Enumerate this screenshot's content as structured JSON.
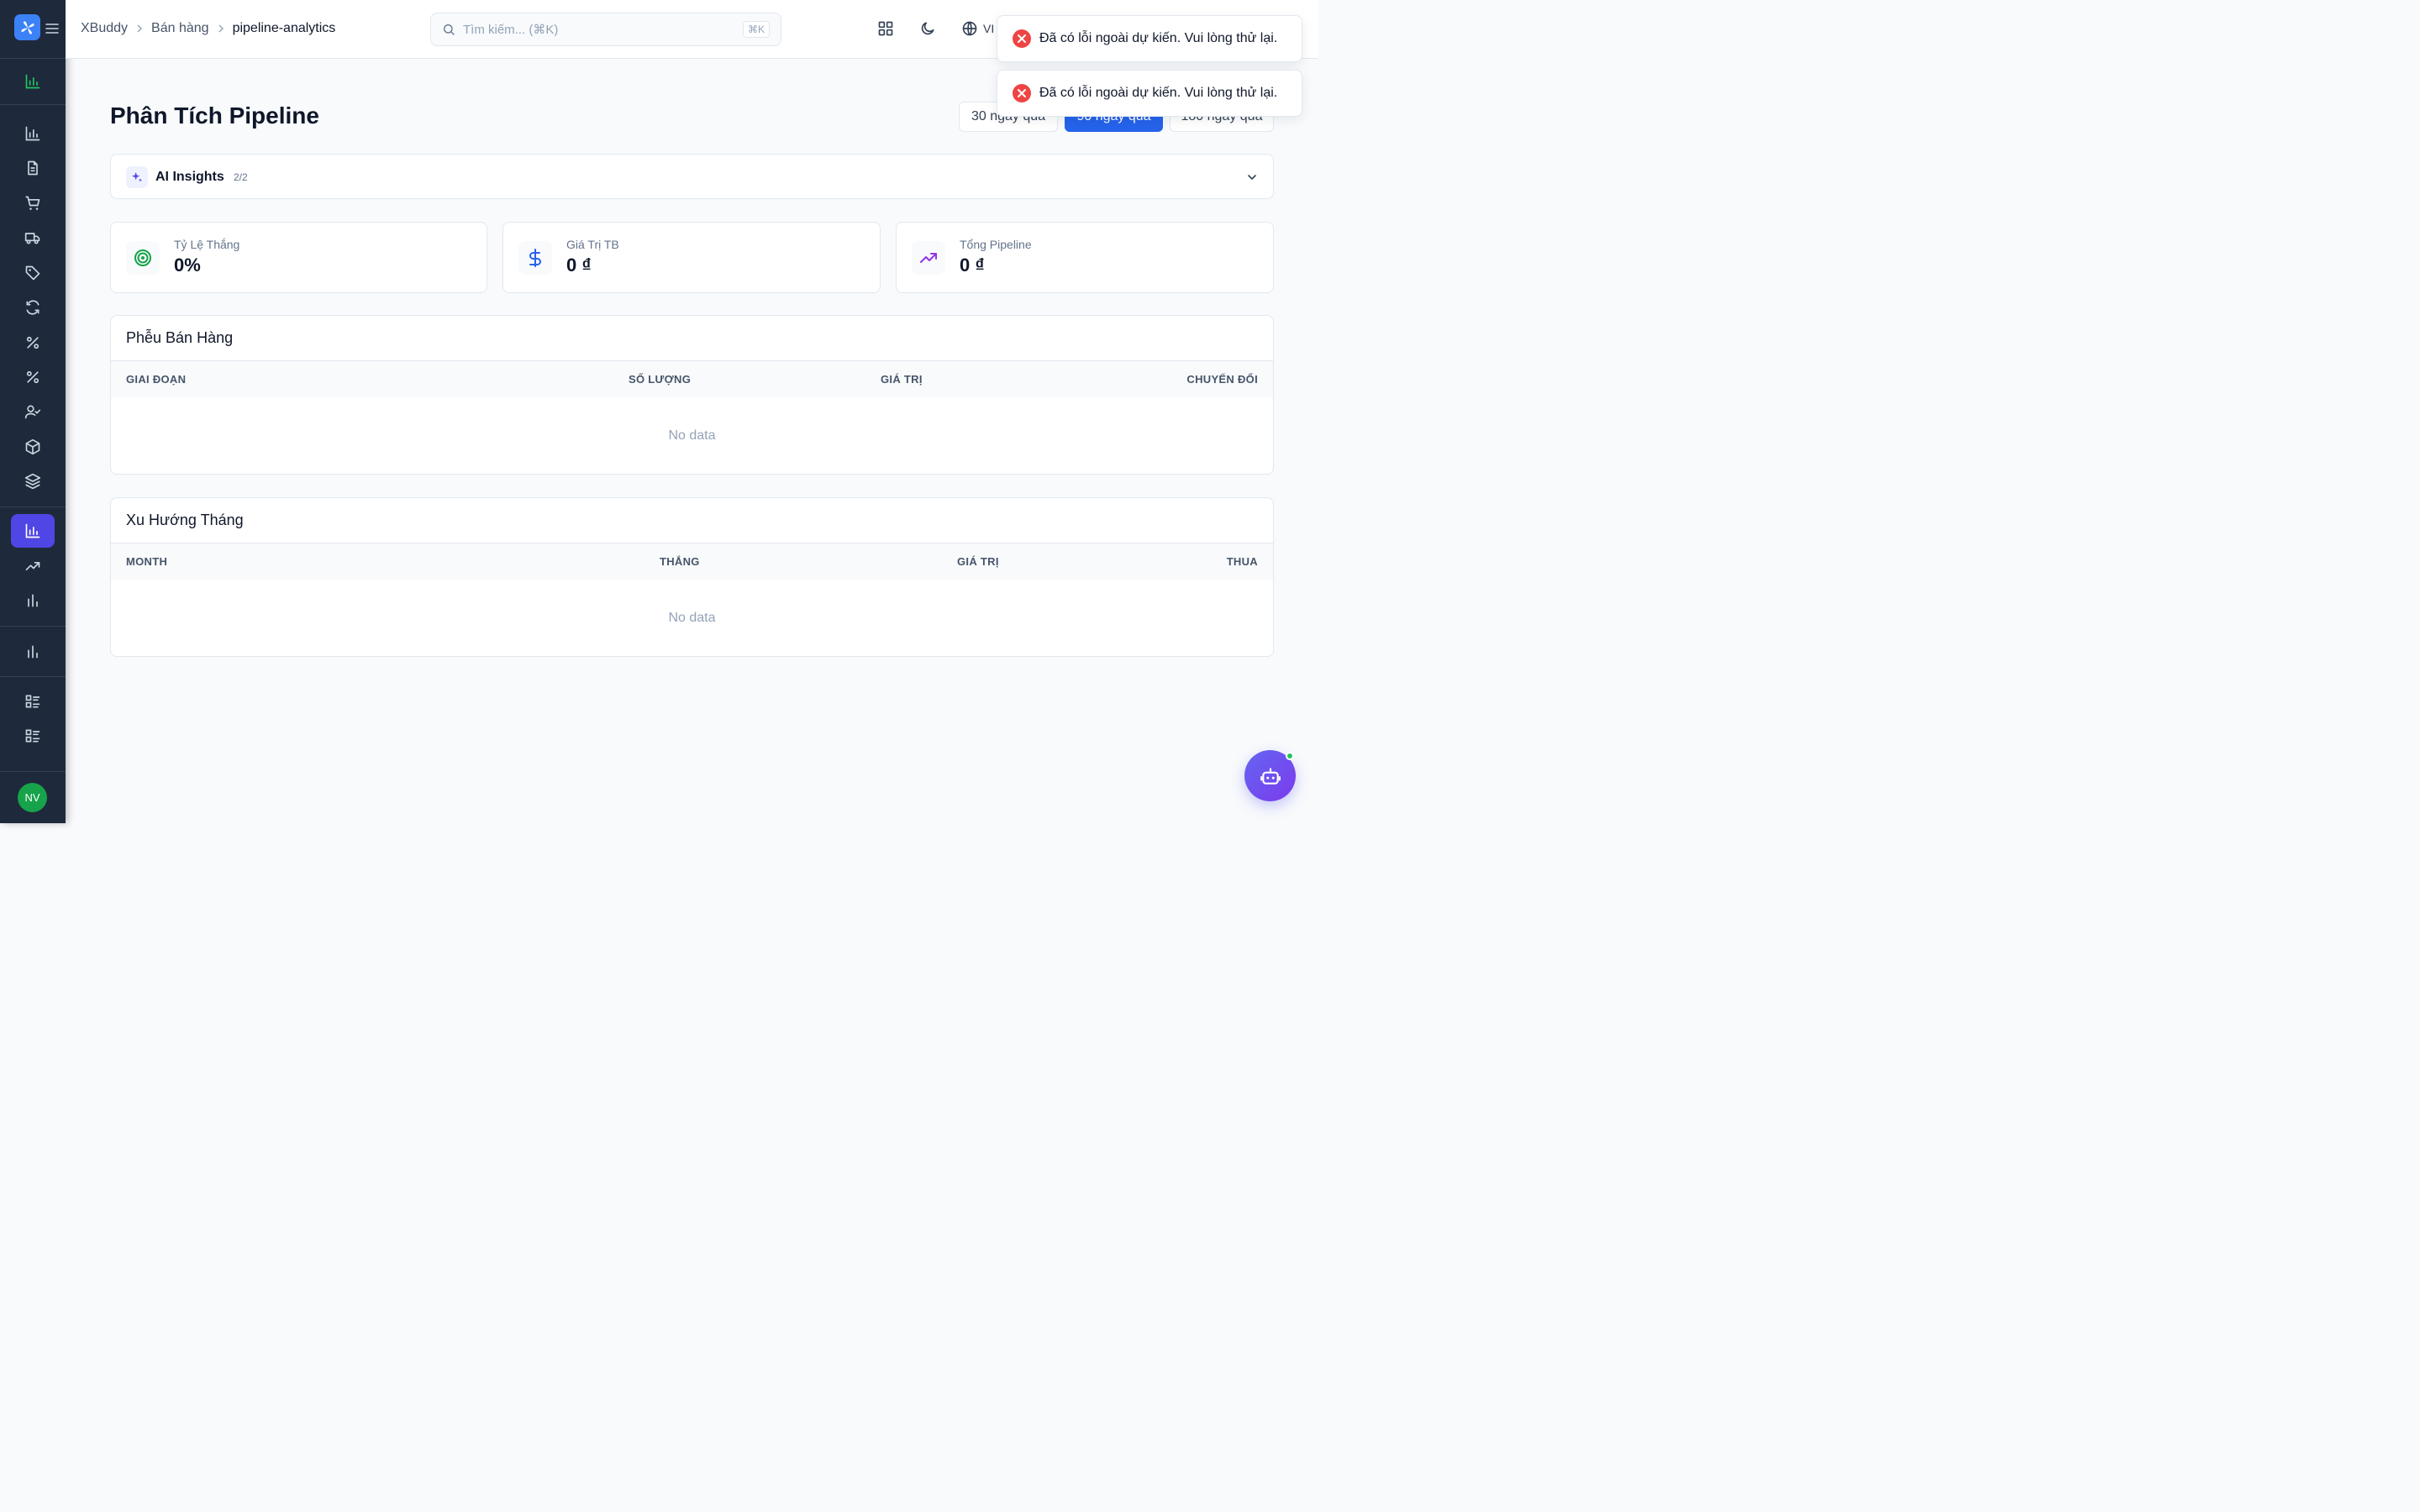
{
  "sidebar": {
    "items": [
      {
        "icon": "bar-chart-icon"
      },
      {
        "icon": "bar-chart-icon"
      },
      {
        "icon": "document-icon"
      },
      {
        "icon": "cart-icon"
      },
      {
        "icon": "truck-icon"
      },
      {
        "icon": "tag-icon"
      },
      {
        "icon": "refresh-icon"
      },
      {
        "icon": "percent-icon"
      },
      {
        "icon": "percent-icon"
      },
      {
        "icon": "user-check-icon"
      },
      {
        "icon": "box-icon"
      },
      {
        "icon": "layers-icon"
      },
      {
        "icon": "bar-chart-icon",
        "active": true
      },
      {
        "icon": "trending-up-icon"
      },
      {
        "icon": "bar-chart-icon"
      },
      {
        "icon": "bar-chart-icon"
      },
      {
        "icon": "list-icon"
      },
      {
        "icon": "list-icon"
      }
    ],
    "avatar_initials": "NV",
    "accent": "#4f46e5"
  },
  "header": {
    "breadcrumb": [
      "XBuddy",
      "Bán hàng",
      "pipeline-analytics"
    ],
    "search_placeholder": "Tìm kiếm... (⌘K)",
    "search_shortcut": "⌘K",
    "language": "VI"
  },
  "page": {
    "title": "Phân Tích Pipeline",
    "ranges": [
      "30 ngày qua",
      "90 ngày qua",
      "180 ngày qua"
    ],
    "selected_range": "90 ngày qua"
  },
  "ai_insights": {
    "label": "AI Insights",
    "count": "2/2"
  },
  "stats": [
    {
      "label": "Tỷ Lệ Thắng",
      "value": "0%",
      "icon": "target-icon",
      "color": "#16a34a"
    },
    {
      "label": "Giá Trị TB",
      "value": "0 ₫",
      "icon": "dollar-icon",
      "color": "#2563eb"
    },
    {
      "label": "Tổng Pipeline",
      "value": "0 ₫",
      "icon": "trending-up-icon",
      "color": "#9333ea"
    }
  ],
  "funnel": {
    "title": "Phễu Bán Hàng",
    "columns": [
      "GIAI ĐOẠN",
      "SỐ LƯỢNG",
      "GIÁ TRỊ",
      "CHUYỂN ĐỔI"
    ],
    "empty": "No data"
  },
  "trend": {
    "title": "Xu Hướng Tháng",
    "columns": [
      "MONTH",
      "THẮNG",
      "GIÁ TRỊ",
      "THUA"
    ],
    "empty": "No data"
  },
  "toasts": [
    {
      "message": "Đã có lỗi ngoài dự kiến. Vui lòng thử lại.",
      "type": "error"
    },
    {
      "message": "Đã có lỗi ngoài dự kiến. Vui lòng thử lại.",
      "type": "error"
    }
  ],
  "colors": {
    "primary": "#2563eb",
    "error": "#ef4444",
    "sidebar_bg": "#1e293b"
  }
}
